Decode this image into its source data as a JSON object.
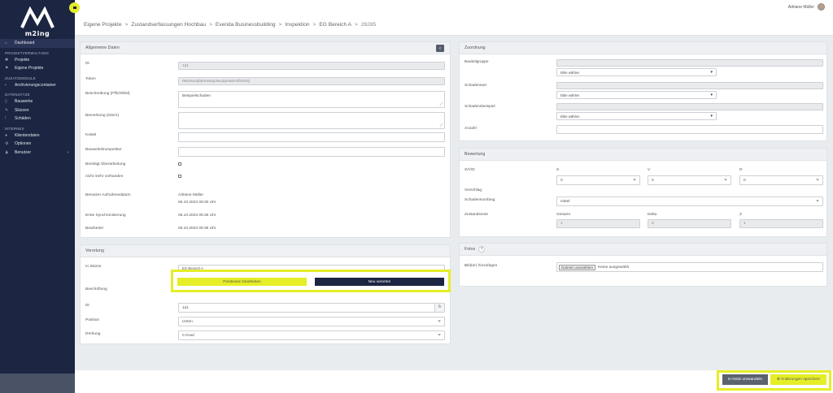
{
  "app": {
    "logo_text": "m2ing"
  },
  "sidebar": {
    "dashboard": "Dashboard",
    "sections": {
      "projekt": "PROJEKTVERWALTUNG",
      "zusatz": "ZUSATZMODULE",
      "daten": "DATENSÄTZE",
      "internes": "INTERNES"
    },
    "projekt_items": [
      "Projekte",
      "Eigene Projekte"
    ],
    "zusatz_items": [
      "Archivierungscontainer"
    ],
    "daten_items": [
      "Bauwerke",
      "Skizzen",
      "Schäden"
    ],
    "internes_items": [
      "Klientendaten",
      "Optionen",
      "Benutzer"
    ]
  },
  "topbar": {
    "user_name": "Adriane Müller"
  },
  "breadcrumb": [
    "Eigene Projekte",
    "Zustandserfassungen Hochbau",
    "Everida Businessbuilding",
    "Inspektion",
    "EG Bereich A",
    "26285"
  ],
  "allgemein": {
    "title": "Allgemeine Daten",
    "id_label": "ID",
    "id_value": "1d1",
    "token_label": "Token",
    "token_value": "I9sGsuzqfuhmantpJwuzpmaimcllzmhQ",
    "beschreibung_label": "Beschreibung (Pflichtfeld)",
    "beschreibung_value": "Beispielschaden",
    "bemerkung_label": "Bemerkung (intern)",
    "kosten_label": "Kostel",
    "bauwerks_label": "Bauwerkskomposttur",
    "ueberarbeitung_label": "Benötigt Überarbeitung",
    "nicht_label": "nicht mehr vorhanden",
    "benutzer_label": "Benutzer Aufnahmedatum",
    "benutzer_value": "Adriane Müller",
    "benutzer_date": "05.10.2023 09:30 Uhr",
    "sync_label": "Erste Synchronisierung",
    "sync_value": "05.10.2023 09:36 Uhr",
    "bearbeitet_label": "Bearbeitet",
    "bearbeitet_value": "05.10.2023 09:36 Uhr"
  },
  "verortung": {
    "title": "Verortung",
    "skizze_label": "In Skizze",
    "skizze_value": "EG Bereich A",
    "btn_positionen": "Positionen bearbeiten",
    "btn_neu": "Neu verorten",
    "beschriftung_label": "Beschriftung",
    "id_label": "ID",
    "id_value": "1d1",
    "position_label": "Position",
    "position_value": "Unten",
    "drehung_label": "Drehung",
    "drehung_value": "0 Grad"
  },
  "zuordnung": {
    "title": "Zuordnung",
    "bauteil_label": "Bauteilgruppe",
    "schadensart_label": "Schadensart",
    "schadensbeispiel_label": "Schadensbeispiel",
    "anzahl_label": "Anzahl",
    "select_placeholder": "Bitte wählen"
  },
  "bewertung": {
    "title": "Bewertung",
    "svd_label": "S/V/D",
    "s_label": "S",
    "v_label": "V",
    "d_label": "D",
    "s_value": "0",
    "v_value": "0",
    "d_value": "0",
    "vorschlag_label": "Vorschlag",
    "umfang_label": "Schadensumfang",
    "umfang_value": "mittel",
    "zustand_label": "Zustandsnote",
    "gesamt_label": "Gesamt",
    "delta_label": "Delta",
    "z_label": "Z",
    "gesamt_value": "1",
    "delta_value": "0",
    "z_value": "1"
  },
  "fotos": {
    "title": "Fotos",
    "bilder_label": "Bild(er) hinzufügen",
    "file_button": "Dateien auswählen",
    "file_status": "Keine ausgewählt"
  },
  "footer": {
    "notiz_button": "In Notiz umwandeln",
    "save_button": "Änderungen speichern"
  },
  "colors": {
    "sidebar": "#1c2541",
    "accent_yellow": "#e5ee26"
  }
}
